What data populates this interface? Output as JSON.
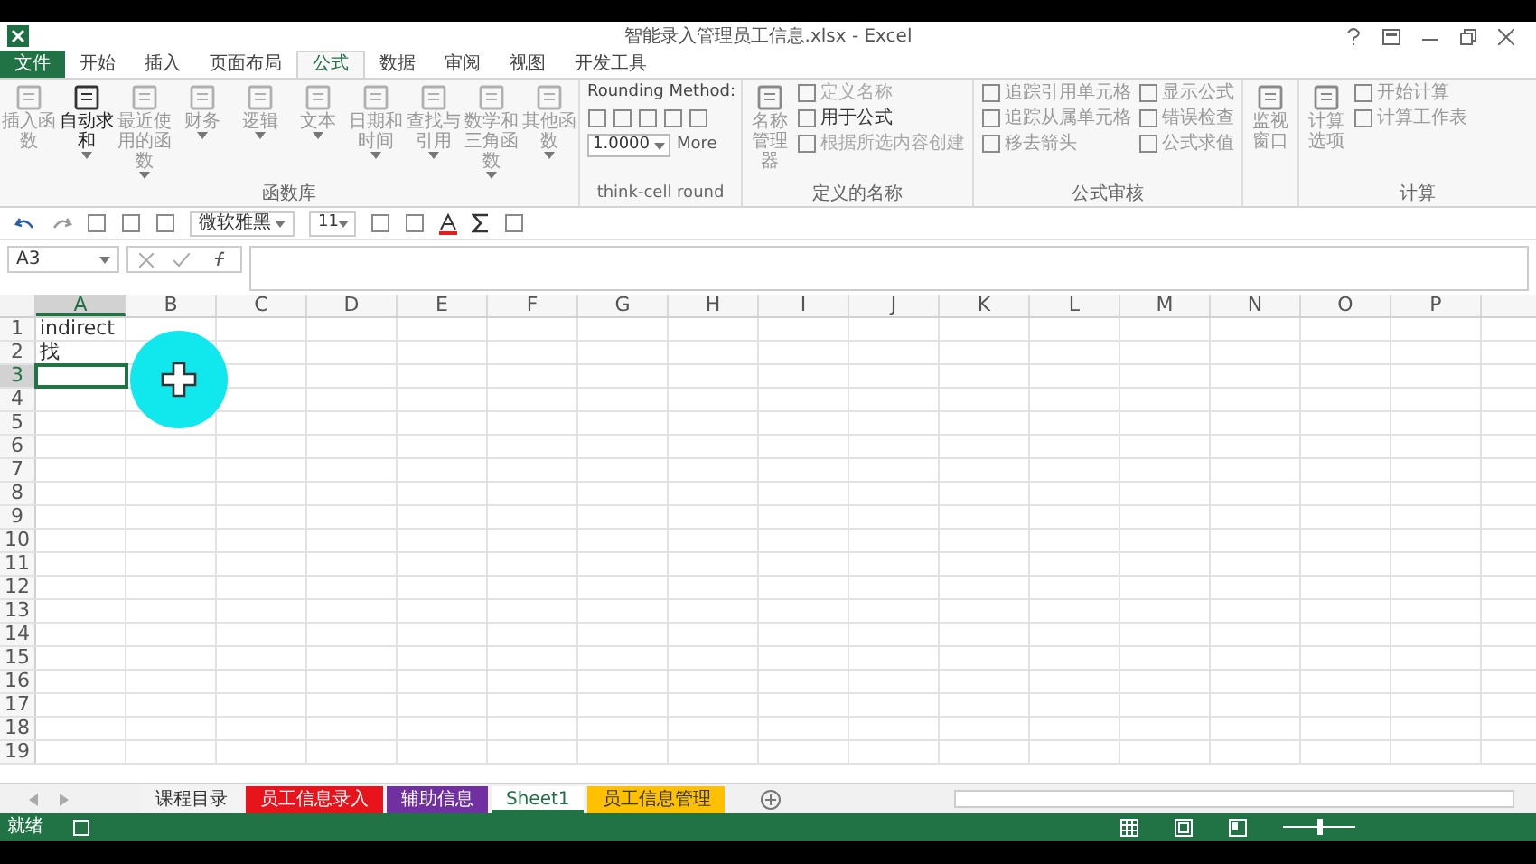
{
  "window": {
    "title": "智能录入管理员工信息.xlsx - Excel"
  },
  "file_tab": "文件",
  "tabs": [
    {
      "label": "开始",
      "selected": false
    },
    {
      "label": "插入",
      "selected": false
    },
    {
      "label": "页面布局",
      "selected": false
    },
    {
      "label": "公式",
      "selected": true
    },
    {
      "label": "数据",
      "selected": false
    },
    {
      "label": "审阅",
      "selected": false
    },
    {
      "label": "视图",
      "selected": false
    },
    {
      "label": "开发工具",
      "selected": false
    }
  ],
  "ribbon": {
    "function_library": {
      "label": "函数库",
      "buttons": [
        {
          "label": "插入函数",
          "disabled": true,
          "dropdown": false
        },
        {
          "label": "自动求和",
          "disabled": false,
          "dropdown": true
        },
        {
          "label": "最近使用的函数",
          "disabled": true,
          "dropdown": true
        },
        {
          "label": "财务",
          "disabled": true,
          "dropdown": true
        },
        {
          "label": "逻辑",
          "disabled": true,
          "dropdown": true
        },
        {
          "label": "文本",
          "disabled": true,
          "dropdown": true
        },
        {
          "label": "日期和时间",
          "disabled": true,
          "dropdown": true
        },
        {
          "label": "查找与引用",
          "disabled": true,
          "dropdown": true
        },
        {
          "label": "数学和三角函数",
          "disabled": true,
          "dropdown": true
        },
        {
          "label": "其他函数",
          "disabled": true,
          "dropdown": true
        }
      ]
    },
    "think_cell": {
      "label": "think-cell round",
      "heading": "Rounding Method:",
      "value": "1.0000",
      "more": "More"
    },
    "defined_names": {
      "label": "定义的名称",
      "big": "名称管理器",
      "items": [
        {
          "label": "定义名称",
          "disabled": true
        },
        {
          "label": "用于公式",
          "disabled": false
        },
        {
          "label": "根据所选内容创建",
          "disabled": true
        }
      ]
    },
    "formula_auditing": {
      "label": "公式审核",
      "items": [
        {
          "label": "追踪引用单元格"
        },
        {
          "label": "显示公式"
        },
        {
          "label": "追踪从属单元格"
        },
        {
          "label": "错误检查"
        },
        {
          "label": "移去箭头"
        },
        {
          "label": "公式求值"
        }
      ]
    },
    "watch": {
      "label": "监视窗口"
    },
    "calculation": {
      "label": "计算",
      "big": "计算选项",
      "items": [
        {
          "label": "开始计算"
        },
        {
          "label": "计算工作表"
        }
      ]
    }
  },
  "toolbar": {
    "font": "微软雅黑",
    "size": "11"
  },
  "formula_bar": {
    "name_box": "A3"
  },
  "columns": [
    {
      "label": "A",
      "selected": true
    },
    {
      "label": "B",
      "selected": false
    },
    {
      "label": "C",
      "selected": false
    },
    {
      "label": "D",
      "selected": false
    },
    {
      "label": "E",
      "selected": false
    },
    {
      "label": "F",
      "selected": false
    },
    {
      "label": "G",
      "selected": false
    },
    {
      "label": "H",
      "selected": false
    },
    {
      "label": "I",
      "selected": false
    },
    {
      "label": "J",
      "selected": false
    },
    {
      "label": "K",
      "selected": false
    },
    {
      "label": "L",
      "selected": false
    },
    {
      "label": "M",
      "selected": false
    },
    {
      "label": "N",
      "selected": false
    },
    {
      "label": "O",
      "selected": false
    },
    {
      "label": "P",
      "selected": false
    }
  ],
  "rows": [
    {
      "label": "1",
      "selected": false,
      "cells": [
        "indirect"
      ]
    },
    {
      "label": "2",
      "selected": false,
      "cells": [
        "找"
      ]
    },
    {
      "label": "3",
      "selected": true,
      "cells": []
    },
    {
      "label": "4",
      "selected": false,
      "cells": []
    },
    {
      "label": "5",
      "selected": false,
      "cells": []
    },
    {
      "label": "6",
      "selected": false,
      "cells": []
    },
    {
      "label": "7",
      "selected": false,
      "cells": []
    },
    {
      "label": "8",
      "selected": false,
      "cells": []
    },
    {
      "label": "9",
      "selected": false,
      "cells": []
    },
    {
      "label": "10",
      "selected": false,
      "cells": []
    },
    {
      "label": "11",
      "selected": false,
      "cells": []
    },
    {
      "label": "12",
      "selected": false,
      "cells": []
    },
    {
      "label": "13",
      "selected": false,
      "cells": []
    },
    {
      "label": "14",
      "selected": false,
      "cells": []
    },
    {
      "label": "15",
      "selected": false,
      "cells": []
    },
    {
      "label": "16",
      "selected": false,
      "cells": []
    },
    {
      "label": "17",
      "selected": false,
      "cells": []
    },
    {
      "label": "18",
      "selected": false,
      "cells": []
    },
    {
      "label": "19",
      "selected": false,
      "cells": []
    }
  ],
  "sheet_tabs": [
    {
      "label": "课程目录",
      "selected": false,
      "color": "#f3f3f3"
    },
    {
      "label": "员工信息录入",
      "selected": false,
      "color": "#e8141c"
    },
    {
      "label": "辅助信息",
      "selected": false,
      "color": "#7030a0"
    },
    {
      "label": "Sheet1",
      "selected": true,
      "color": "#ffffff"
    },
    {
      "label": "员工信息管理",
      "selected": false,
      "color": "#ffc000"
    }
  ],
  "status_bar": {
    "text": "就绪",
    "zoom": {
      "level": 0.5
    }
  }
}
